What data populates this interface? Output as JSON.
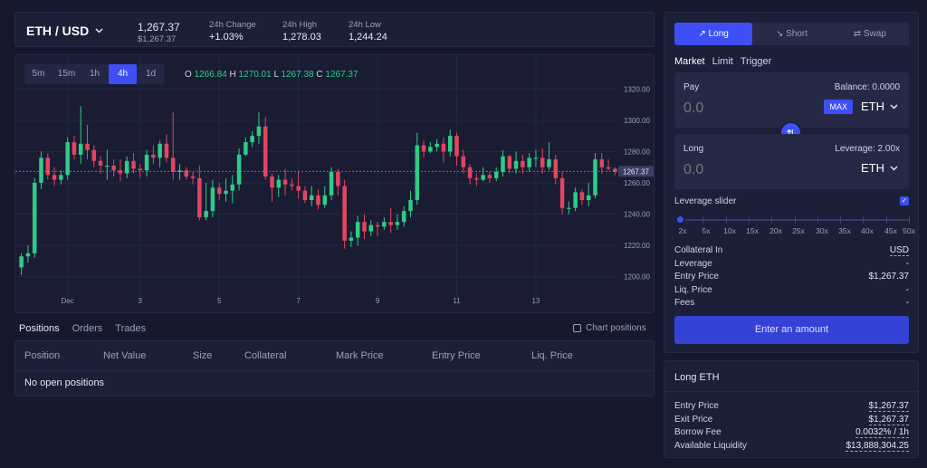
{
  "ticker": {
    "pair": "ETH / USD",
    "price": "1,267.37",
    "price_usd": "$1,267.37",
    "change_label": "24h Change",
    "change_value": "+1.03%",
    "high_label": "24h High",
    "high_value": "1,278.03",
    "low_label": "24h Low",
    "low_value": "1,244.24"
  },
  "chart": {
    "timeframes": [
      "5m",
      "15m",
      "1h",
      "4h",
      "1d"
    ],
    "active_timeframe": "4h",
    "ohlc": {
      "o_label": "O",
      "o": "1266.84",
      "h_label": "H",
      "h": "1270.01",
      "l_label": "L",
      "l": "1267.38",
      "c_label": "C",
      "c": "1267.37"
    },
    "current_price_label": "1267.37",
    "colors": {
      "up": "#2ecc86",
      "down": "#e0465f",
      "accent": "#3d4ff5"
    }
  },
  "chart_data": {
    "type": "candlestick",
    "ylim": [
      1190,
      1330
    ],
    "yticks": [
      "1320.00",
      "1300.00",
      "1280.00",
      "1260.00",
      "1240.00",
      "1220.00",
      "1200.00"
    ],
    "xticks": [
      "Dec",
      "3",
      "5",
      "7",
      "9",
      "11",
      "13"
    ],
    "last_price": 1267.37,
    "candles": [
      [
        1206,
        1213,
        1201,
        1215
      ],
      [
        1213,
        1215,
        1209,
        1220
      ],
      [
        1215,
        1260,
        1212,
        1263
      ],
      [
        1260,
        1276,
        1256,
        1280
      ],
      [
        1276,
        1265,
        1262,
        1279
      ],
      [
        1265,
        1262,
        1258,
        1270
      ],
      [
        1262,
        1265,
        1259,
        1268
      ],
      [
        1265,
        1286,
        1262,
        1289
      ],
      [
        1286,
        1278,
        1275,
        1290
      ],
      [
        1278,
        1285,
        1272,
        1309
      ],
      [
        1285,
        1281,
        1275,
        1297
      ],
      [
        1281,
        1274,
        1270,
        1284
      ],
      [
        1274,
        1271,
        1266,
        1277
      ],
      [
        1271,
        1271,
        1262,
        1281
      ],
      [
        1271,
        1268,
        1264,
        1275
      ],
      [
        1268,
        1266,
        1261,
        1275
      ],
      [
        1266,
        1274,
        1263,
        1277
      ],
      [
        1274,
        1269,
        1266,
        1279
      ],
      [
        1269,
        1268,
        1263,
        1272
      ],
      [
        1268,
        1278,
        1264,
        1281
      ],
      [
        1278,
        1276,
        1272,
        1284
      ],
      [
        1276,
        1285,
        1270,
        1287
      ],
      [
        1285,
        1276,
        1273,
        1291
      ],
      [
        1276,
        1267,
        1262,
        1305
      ],
      [
        1267,
        1268,
        1262,
        1272
      ],
      [
        1268,
        1264,
        1262,
        1270
      ],
      [
        1264,
        1263,
        1259,
        1267
      ],
      [
        1263,
        1238,
        1236,
        1271
      ],
      [
        1238,
        1242,
        1236,
        1260
      ],
      [
        1242,
        1257,
        1238,
        1262
      ],
      [
        1257,
        1253,
        1249,
        1260
      ],
      [
        1253,
        1255,
        1248,
        1263
      ],
      [
        1255,
        1259,
        1247,
        1265
      ],
      [
        1259,
        1278,
        1255,
        1282
      ],
      [
        1278,
        1286,
        1277,
        1289
      ],
      [
        1286,
        1290,
        1283,
        1293
      ],
      [
        1290,
        1296,
        1285,
        1305
      ],
      [
        1296,
        1264,
        1262,
        1302
      ],
      [
        1264,
        1257,
        1248,
        1266
      ],
      [
        1257,
        1262,
        1251,
        1265
      ],
      [
        1262,
        1259,
        1252,
        1269
      ],
      [
        1259,
        1258,
        1255,
        1263
      ],
      [
        1258,
        1255,
        1250,
        1267
      ],
      [
        1255,
        1249,
        1247,
        1258
      ],
      [
        1249,
        1252,
        1245,
        1258
      ],
      [
        1252,
        1246,
        1243,
        1256
      ],
      [
        1246,
        1252,
        1244,
        1258
      ],
      [
        1252,
        1267,
        1249,
        1270
      ],
      [
        1267,
        1258,
        1252,
        1269
      ],
      [
        1258,
        1223,
        1218,
        1262
      ],
      [
        1223,
        1225,
        1219,
        1229
      ],
      [
        1225,
        1235,
        1220,
        1239
      ],
      [
        1235,
        1229,
        1224,
        1240
      ],
      [
        1229,
        1233,
        1226,
        1236
      ],
      [
        1233,
        1232,
        1226,
        1235
      ],
      [
        1232,
        1235,
        1230,
        1238
      ],
      [
        1235,
        1233,
        1228,
        1244
      ],
      [
        1233,
        1235,
        1230,
        1240
      ],
      [
        1235,
        1242,
        1232,
        1245
      ],
      [
        1242,
        1249,
        1238,
        1255
      ],
      [
        1249,
        1284,
        1246,
        1292
      ],
      [
        1284,
        1280,
        1276,
        1287
      ],
      [
        1280,
        1283,
        1279,
        1286
      ],
      [
        1283,
        1285,
        1280,
        1288
      ],
      [
        1285,
        1280,
        1273,
        1289
      ],
      [
        1280,
        1290,
        1277,
        1294
      ],
      [
        1290,
        1277,
        1271,
        1292
      ],
      [
        1277,
        1270,
        1266,
        1281
      ],
      [
        1270,
        1263,
        1259,
        1272
      ],
      [
        1263,
        1262,
        1258,
        1266
      ],
      [
        1262,
        1265,
        1261,
        1270
      ],
      [
        1265,
        1263,
        1260,
        1267
      ],
      [
        1263,
        1267,
        1261,
        1270
      ],
      [
        1267,
        1277,
        1264,
        1281
      ],
      [
        1277,
        1269,
        1266,
        1278
      ],
      [
        1269,
        1274,
        1266,
        1280
      ],
      [
        1274,
        1270,
        1266,
        1278
      ],
      [
        1270,
        1276,
        1267,
        1279
      ],
      [
        1276,
        1276,
        1270,
        1281
      ],
      [
        1276,
        1270,
        1266,
        1282
      ],
      [
        1270,
        1275,
        1268,
        1286
      ],
      [
        1275,
        1263,
        1259,
        1278
      ],
      [
        1263,
        1244,
        1240,
        1267
      ],
      [
        1244,
        1244,
        1240,
        1248
      ],
      [
        1244,
        1254,
        1242,
        1257
      ],
      [
        1254,
        1249,
        1246,
        1256
      ],
      [
        1249,
        1252,
        1245,
        1260
      ],
      [
        1252,
        1275,
        1250,
        1279
      ],
      [
        1275,
        1270,
        1266,
        1279
      ],
      [
        1270,
        1269,
        1268,
        1275
      ],
      [
        1269,
        1267,
        1265,
        1270
      ]
    ]
  },
  "positions": {
    "tabs": [
      "Positions",
      "Orders",
      "Trades"
    ],
    "chart_positions_label": "Chart positions",
    "columns": [
      "Position",
      "Net Value",
      "Size",
      "Collateral",
      "Mark Price",
      "Entry Price",
      "Liq. Price"
    ],
    "empty_text": "No open positions"
  },
  "trade": {
    "modes": [
      "Long",
      "Short",
      "Swap"
    ],
    "order_types": [
      "Market",
      "Limit",
      "Trigger"
    ],
    "pay_label": "Pay",
    "balance": "Balance: 0.0000",
    "pay_amount_placeholder": "0.0",
    "max_label": "MAX",
    "pay_token": "ETH",
    "long_label": "Long",
    "leverage_label": "Leverage: 2.00x",
    "long_amount_placeholder": "0.0",
    "long_token": "ETH",
    "leverage_slider_label": "Leverage slider",
    "slider_marks": [
      "2x",
      "5x",
      "10x",
      "15x",
      "20x",
      "25x",
      "30x",
      "35x",
      "40x",
      "45x",
      "50x"
    ],
    "leverage_value": 0,
    "collateral_label": "Collateral In",
    "collateral_value": "USD",
    "leverage_row_label": "Leverage",
    "leverage_row_value": "-",
    "entry_label": "Entry Price",
    "entry_value": "$1,267.37",
    "liq_label": "Liq. Price",
    "liq_value": "-",
    "fees_label": "Fees",
    "fees_value": "-",
    "cta": "Enter an amount"
  },
  "summary": {
    "title": "Long ETH",
    "rows": [
      {
        "label": "Entry Price",
        "value": "$1,267.37"
      },
      {
        "label": "Exit Price",
        "value": "$1,267.37"
      },
      {
        "label": "Borrow Fee",
        "value": "0.0032% / 1h"
      },
      {
        "label": "Available Liquidity",
        "value": "$13,888,304.25"
      }
    ]
  }
}
